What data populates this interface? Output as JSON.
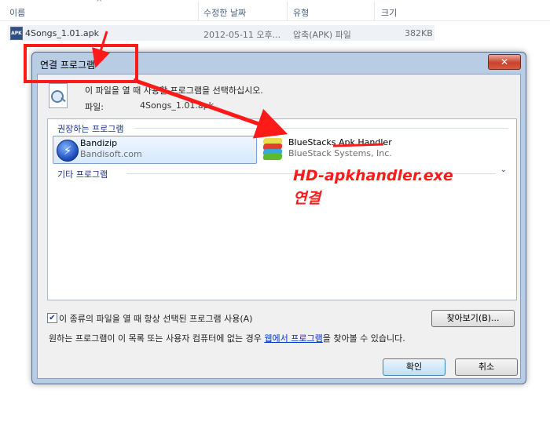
{
  "columns": [
    {
      "label": "이름"
    },
    {
      "label": "수정한 날짜"
    },
    {
      "label": "유형"
    },
    {
      "label": "크기"
    }
  ],
  "file": {
    "name": "4Songs_1.01.apk",
    "modified": "2012-05-11 오후...",
    "type": "압축(APK) 파일",
    "size": "382KB",
    "icon_text": "APK"
  },
  "dialog": {
    "title": "연결 프로그램",
    "close_glyph": "✕",
    "message": "이 파일을 열 때 사용할 프로그램을 선택하십시오.",
    "file_label": "파일:",
    "file_name": "4Songs_1.01.apk",
    "recommended_header": "권장하는 프로그램",
    "other_header": "기타 프로그램",
    "programs": [
      {
        "name": "Bandizip",
        "vendor": "Bandisoft.com",
        "selected": true,
        "icon": "bandizip-icon"
      },
      {
        "name": "BlueStacks Apk Handler",
        "vendor": "BlueStack Systems, Inc.",
        "selected": false,
        "icon": "bluestacks-icon"
      }
    ],
    "always_use_label": "이 종류의 파일을 열 때 항상 선택된 프로그램 사용(A)",
    "always_use_checked": true,
    "browse_label": "찾아보기(B)...",
    "hint_prefix": "원하는 프로그램이 이 목록 또는 사용자 컴퓨터에 없는 경우 ",
    "hint_link": "웹에서 프로그램",
    "hint_suffix": "을 찾아볼 수 있습니다.",
    "ok_label": "확인",
    "cancel_label": "취소"
  },
  "annotation": {
    "line1": "HD-apkhandler.exe",
    "line2": "연결",
    "color": "#ff1a1a"
  }
}
